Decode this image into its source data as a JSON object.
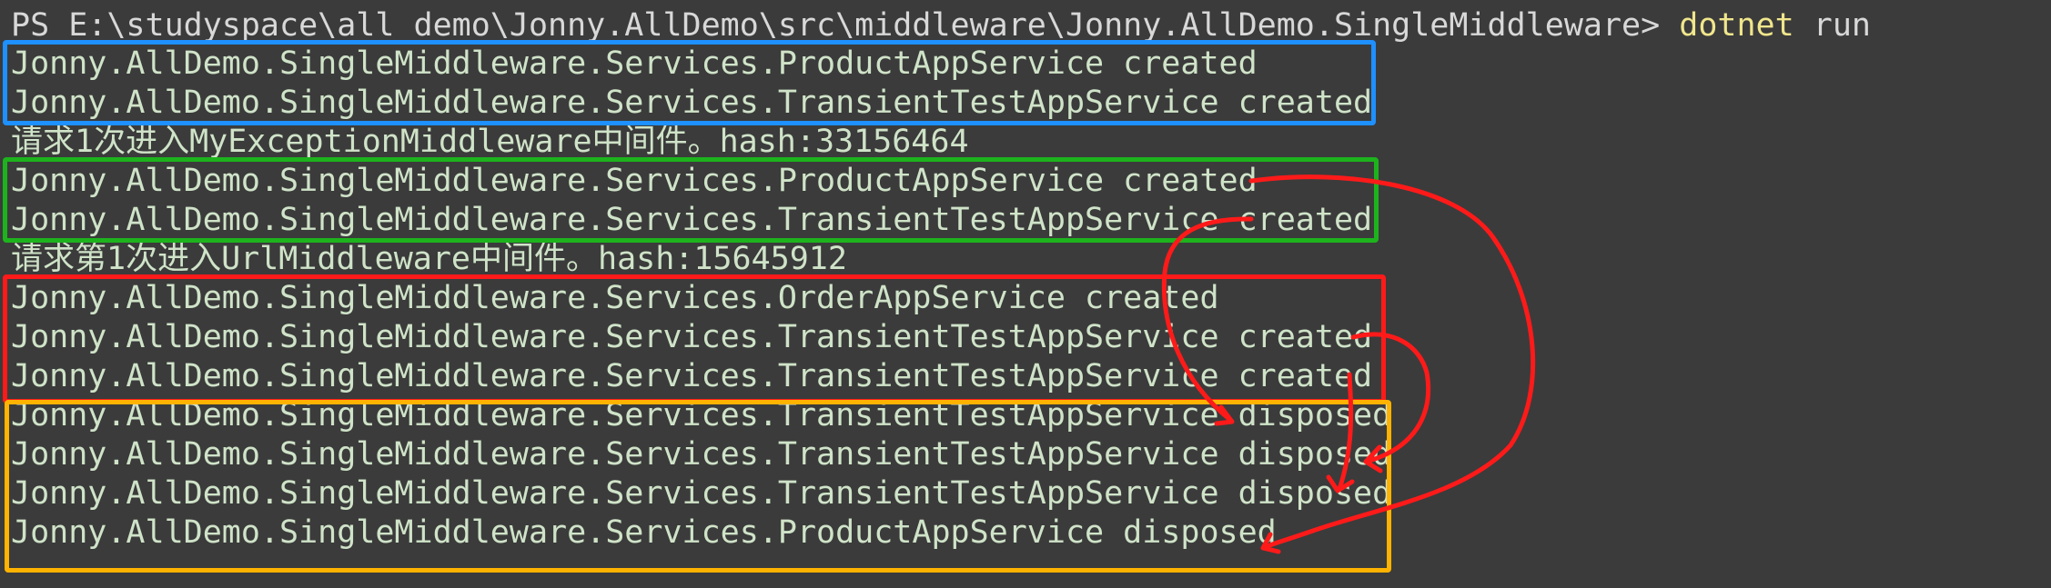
{
  "terminal": {
    "prompt": {
      "path": "PS E:\\studyspace\\all_demo\\Jonny.AllDemo\\src\\middleware\\Jonny.AllDemo.SingleMiddleware>",
      "command": "dotnet",
      "argument": "run"
    },
    "lines": [
      "Jonny.AllDemo.SingleMiddleware.Services.ProductAppService created",
      "Jonny.AllDemo.SingleMiddleware.Services.TransientTestAppService created",
      "请求1次进入MyExceptionMiddleware中间件。hash:33156464",
      "Jonny.AllDemo.SingleMiddleware.Services.ProductAppService created",
      "Jonny.AllDemo.SingleMiddleware.Services.TransientTestAppService created",
      "请求第1次进入UrlMiddleware中间件。hash:15645912",
      "Jonny.AllDemo.SingleMiddleware.Services.OrderAppService created",
      "Jonny.AllDemo.SingleMiddleware.Services.TransientTestAppService created",
      "Jonny.AllDemo.SingleMiddleware.Services.TransientTestAppService created",
      "Jonny.AllDemo.SingleMiddleware.Services.TransientTestAppService disposed",
      "Jonny.AllDemo.SingleMiddleware.Services.TransientTestAppService disposed",
      "Jonny.AllDemo.SingleMiddleware.Services.TransientTestAppService disposed",
      "Jonny.AllDemo.SingleMiddleware.Services.ProductAppService disposed"
    ]
  },
  "annotations": {
    "box_colors": {
      "blue": "#1e90ff",
      "green": "#1db31d",
      "red": "#ff1a1a",
      "orange": "#ffb300"
    },
    "arrow_color": "#ff1a1a"
  },
  "colors": {
    "background": "#3b3b3b",
    "text": "#cfe3c8",
    "command": "#f0e68c"
  }
}
